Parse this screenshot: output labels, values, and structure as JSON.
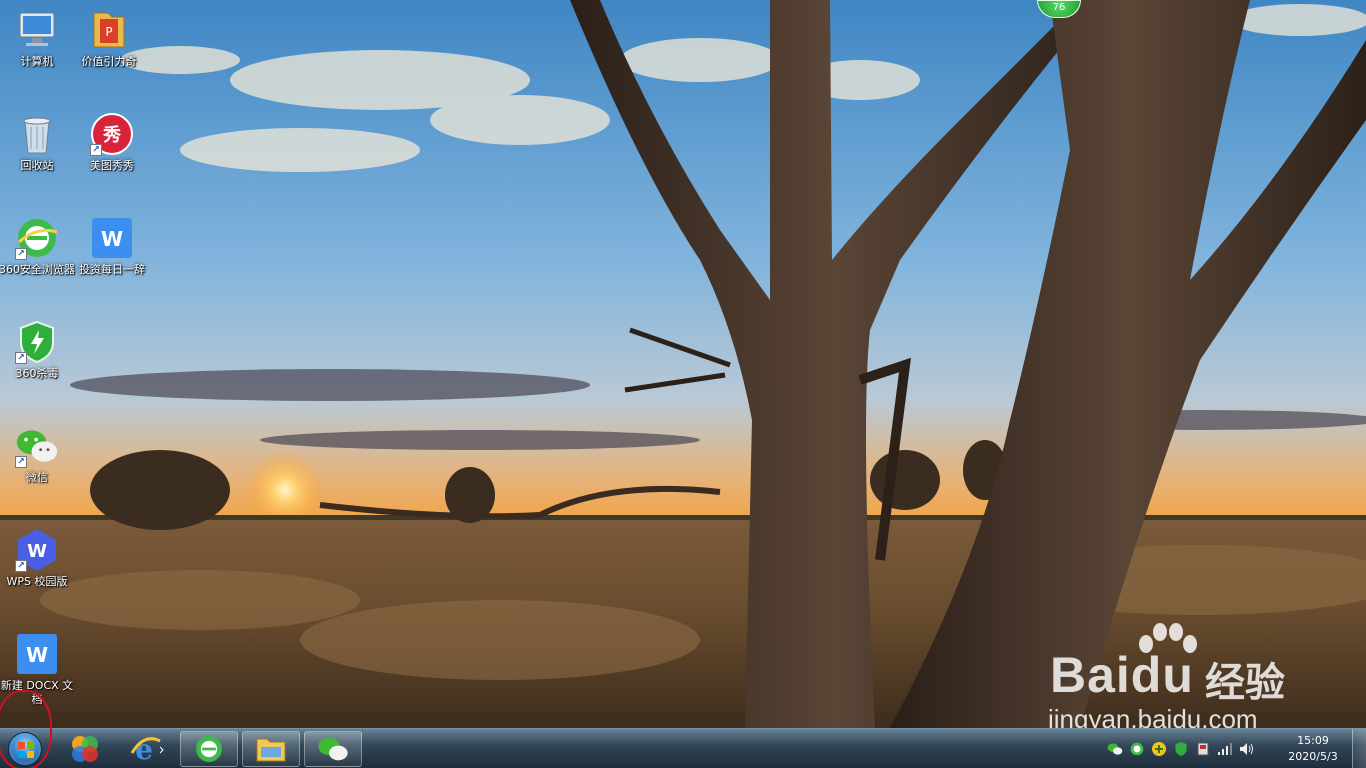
{
  "desktop": {
    "icons": [
      {
        "label": "计算机",
        "icon": "computer-icon"
      },
      {
        "label": "价值引力奇",
        "icon": "folder-icon"
      },
      {
        "label": "回收站",
        "icon": "recycle-bin-icon"
      },
      {
        "label": "美图秀秀",
        "icon": "meitu-icon"
      },
      {
        "label": "360安全浏览器",
        "icon": "browser-360-icon"
      },
      {
        "label": "投资每日一辞",
        "icon": "wps-doc-icon"
      },
      {
        "label": "360杀毒",
        "icon": "antivirus-360-icon"
      },
      {
        "label": "微信",
        "icon": "wechat-icon"
      },
      {
        "label": "WPS 校园版",
        "icon": "wps-campus-icon"
      },
      {
        "label": "新建 DOCX 文档",
        "icon": "docx-icon"
      }
    ],
    "speed_badge": "76",
    "watermark": {
      "brand": "Baidu",
      "cn": "经验",
      "url": "jingyan.baidu.com"
    }
  },
  "taskbar": {
    "pinned": [
      {
        "name": "start-orb",
        "icon": "windows-flag-icon"
      },
      {
        "name": "media-center",
        "icon": "colorful-app-icon"
      },
      {
        "name": "internet-explorer",
        "icon": "ie-icon"
      },
      {
        "name": "browser-360",
        "icon": "browser-360-icon"
      },
      {
        "name": "file-explorer",
        "icon": "folder-icon"
      },
      {
        "name": "wechat",
        "icon": "wechat-icon"
      }
    ],
    "tray_icons": [
      "wechat-tray-icon",
      "browser-360-tray-icon",
      "add-tray-icon",
      "shield-tray-icon",
      "device-tray-icon",
      "signal-icon",
      "volume-icon"
    ],
    "clock": {
      "time": "15:09",
      "date": "2020/5/3"
    }
  },
  "colors": {
    "taskbar": "#1f3446",
    "accent_green": "#2db84a",
    "annotation_red": "#d01020"
  }
}
